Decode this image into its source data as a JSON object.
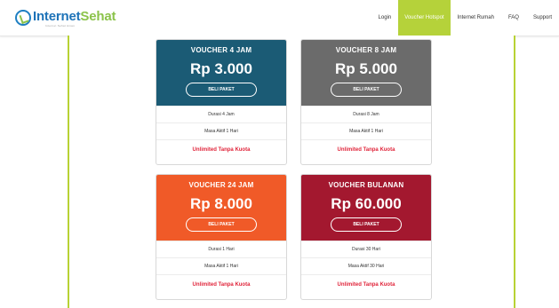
{
  "brand": {
    "name_part1": "Internet",
    "name_part2": "Sehat",
    "tagline": "Internet Sehat Aman"
  },
  "nav": [
    {
      "label": "Login",
      "active": false
    },
    {
      "label": "Voucher Hotspot",
      "active": true
    },
    {
      "label": "Internet Rumah",
      "active": false
    },
    {
      "label": "FAQ",
      "active": false
    },
    {
      "label": "Support",
      "active": false
    }
  ],
  "colors": {
    "accent_green": "#b5d23a",
    "card_4jam": "#1b5b75",
    "card_8jam": "#6b6b6b",
    "card_24jam": "#f05a28",
    "card_bulanan": "#a3182f",
    "unlimited_text": "#e0243a"
  },
  "cards": [
    {
      "title": "VOUCHER 4 JAM",
      "price": "Rp 3.000",
      "button": "BELI PAKET",
      "duration": "Durasi 4 Jam",
      "active_period": "Masa Aktif 1 Hari",
      "quota": "Unlimited Tanpa Kuota"
    },
    {
      "title": "VOUCHER 8 JAM",
      "price": "Rp 5.000",
      "button": "BELI PAKET",
      "duration": "Durasi 8 Jam",
      "active_period": "Masa Aktif 1 Hari",
      "quota": "Unlimited Tanpa Kuota"
    },
    {
      "title": "VOUCHER 24 JAM",
      "price": "Rp 8.000",
      "button": "BELI PAKET",
      "duration": "Durasi 1 Hari",
      "active_period": "Masa Aktif 1 Hari",
      "quota": "Unlimited Tanpa Kuota"
    },
    {
      "title": "VOUCHER BULANAN",
      "price": "Rp 60.000",
      "button": "BELI PAKET",
      "duration": "Durasi 30 Hari",
      "active_period": "Masa Aktif 30 Hari",
      "quota": "Unlimited Tanpa Kuota"
    }
  ]
}
